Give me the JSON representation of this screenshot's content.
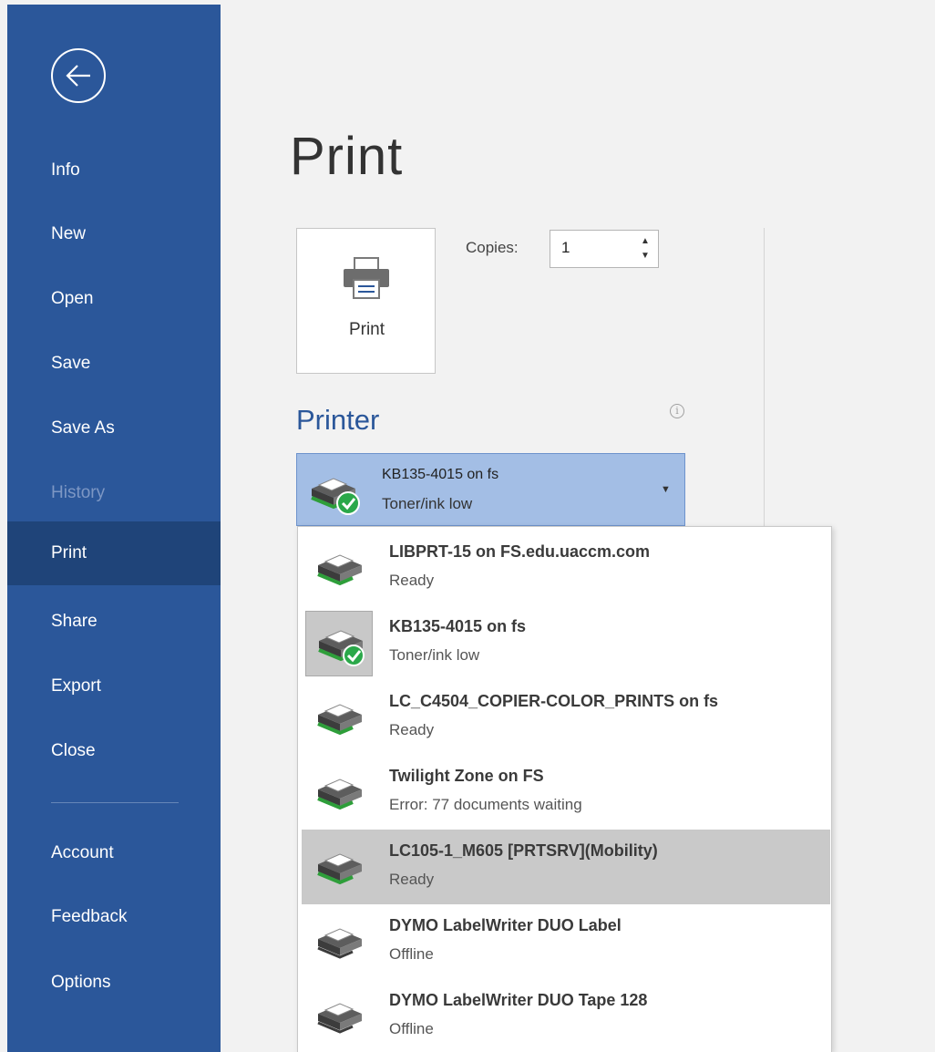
{
  "sidebar": {
    "back_icon": "back-arrow-icon",
    "items": [
      {
        "label": "Info"
      },
      {
        "label": "New"
      },
      {
        "label": "Open"
      },
      {
        "label": "Save"
      },
      {
        "label": "Save As"
      },
      {
        "label": "History"
      },
      {
        "label": "Print"
      },
      {
        "label": "Share"
      },
      {
        "label": "Export"
      },
      {
        "label": "Close"
      },
      {
        "label": "Account"
      },
      {
        "label": "Feedback"
      },
      {
        "label": "Options"
      }
    ],
    "active": "Print",
    "disabled": "History",
    "color": "#2b579a",
    "active_color": "#1f4479"
  },
  "main": {
    "title": "Print",
    "print_button": {
      "label": "Print",
      "icon": "printer-icon"
    },
    "copies": {
      "label": "Copies:",
      "value": "1"
    },
    "printer_section": {
      "title": "Printer",
      "info_icon": "info-icon",
      "selected": {
        "name": "KB135-4015 on fs",
        "status": "Toner/ink low",
        "icon": "printer-default-icon"
      }
    },
    "printer_list": [
      {
        "name": "LIBPRT-15 on FS.edu.uaccm.com",
        "status": "Ready"
      },
      {
        "name": "KB135-4015 on fs",
        "status": "Toner/ink low"
      },
      {
        "name": "LC_C4504_COPIER-COLOR_PRINTS on fs",
        "status": "Ready"
      },
      {
        "name": "Twilight Zone on FS",
        "status": "Error: 77 documents waiting"
      },
      {
        "name": "LC105-1_M605 [PRTSRV](Mobility)",
        "status": "Ready"
      },
      {
        "name": "DYMO LabelWriter DUO Label",
        "status": "Offline"
      },
      {
        "name": "DYMO LabelWriter DUO Tape 128",
        "status": "Offline"
      }
    ]
  }
}
